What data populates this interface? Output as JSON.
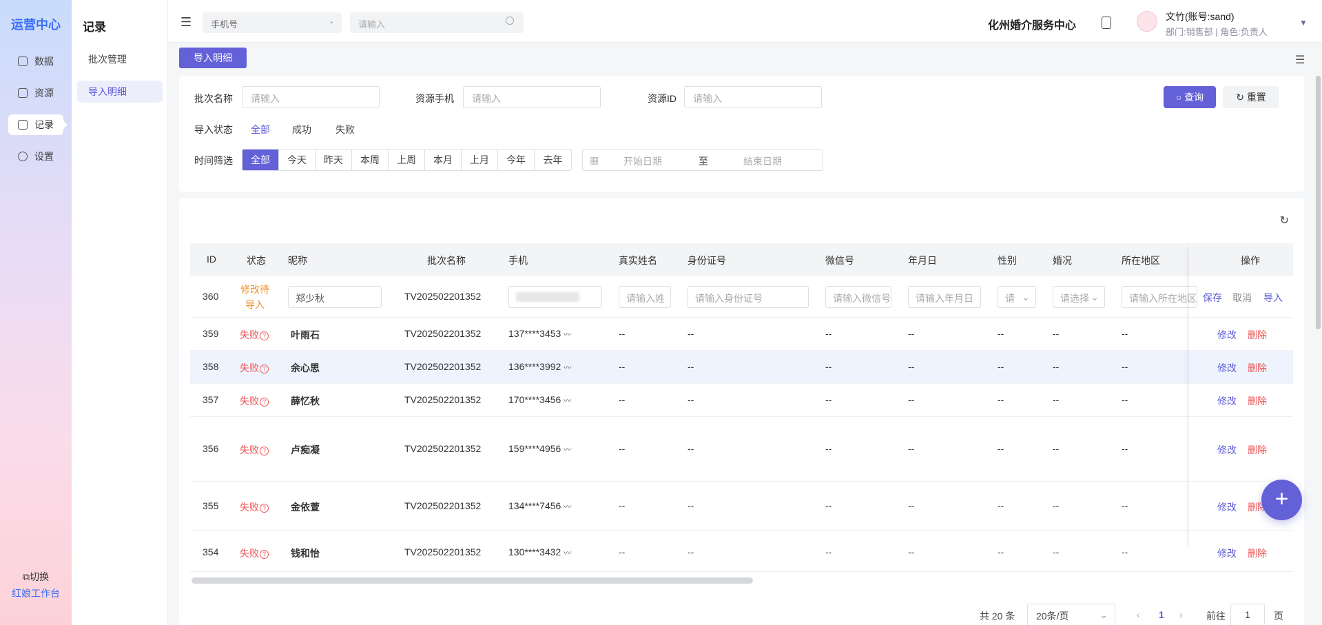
{
  "rail": {
    "brand": "运营中心",
    "items": [
      {
        "label": "数据",
        "icon": "chart-icon"
      },
      {
        "label": "资源",
        "icon": "grid-icon"
      },
      {
        "label": "记录",
        "icon": "document-icon"
      },
      {
        "label": "设置",
        "icon": "gear-icon"
      }
    ],
    "switch_label": "切换",
    "workbench_label": "红娘工作台"
  },
  "submenu": {
    "title": "记录",
    "items": [
      "批次管理",
      "导入明细"
    ],
    "active_index": 1
  },
  "header": {
    "search_type": "手机号",
    "search_placeholder": "请输入",
    "org_name": "化州婚介服务中心",
    "user_name": "文竹(账号:sand)",
    "user_meta": "部门:销售部 | 角色:负责人"
  },
  "page_tab": "导入明细",
  "filters": {
    "batch_name_label": "批次名称",
    "batch_name_placeholder": "请输入",
    "phone_label": "资源手机",
    "phone_placeholder": "请输入",
    "resource_id_label": "资源ID",
    "resource_id_placeholder": "请输入",
    "query_label": "查询",
    "reset_label": "重置",
    "status_label": "导入状态",
    "status_options": [
      "全部",
      "成功",
      "失败"
    ],
    "status_selected": "全部",
    "time_label": "时间筛选",
    "time_options": [
      "全部",
      "今天",
      "昨天",
      "本周",
      "上周",
      "本月",
      "上月",
      "今年",
      "去年"
    ],
    "time_selected": "全部",
    "start_placeholder": "开始日期",
    "range_sep": "至",
    "end_placeholder": "结束日期"
  },
  "table": {
    "columns": [
      "ID",
      "状态",
      "昵称",
      "批次名称",
      "手机",
      "真实姓名",
      "身份证号",
      "微信号",
      "年月日",
      "性别",
      "婚况",
      "所在地区",
      "操作"
    ],
    "edit_row": {
      "id": "360",
      "status": "修改待导入",
      "nickname_value": "郑少秋",
      "batch": "TV202502201352",
      "name_placeholder": "请输入姓",
      "idcard_placeholder": "请输入身份证号",
      "wechat_placeholder": "请输入微信号",
      "birthday_placeholder": "请输入年月日",
      "gender_placeholder": "请",
      "marriage_placeholder": "请选择",
      "region_placeholder": "请输入所在地区",
      "save": "保存",
      "cancel": "取消",
      "import": "导入"
    },
    "rows": [
      {
        "id": "359",
        "status": "失败",
        "nickname": "叶雨石",
        "batch": "TV202502201352",
        "phone": "137****3453",
        "name": "--",
        "idcard": "--",
        "wechat": "--",
        "birthday": "--",
        "gender": "--",
        "marriage": "--",
        "region": "--"
      },
      {
        "id": "358",
        "status": "失败",
        "nickname": "余心思",
        "batch": "TV202502201352",
        "phone": "136****3992",
        "name": "--",
        "idcard": "--",
        "wechat": "--",
        "birthday": "--",
        "gender": "--",
        "marriage": "--",
        "region": "--"
      },
      {
        "id": "357",
        "status": "失败",
        "nickname": "薛忆秋",
        "batch": "TV202502201352",
        "phone": "170****3456",
        "name": "--",
        "idcard": "--",
        "wechat": "--",
        "birthday": "--",
        "gender": "--",
        "marriage": "--",
        "region": "--"
      },
      {
        "id": "356",
        "status": "失败",
        "nickname": "卢痴凝",
        "batch": "TV202502201352",
        "phone": "159****4956",
        "name": "--",
        "idcard": "--",
        "wechat": "--",
        "birthday": "--",
        "gender": "--",
        "marriage": "--",
        "region": "--"
      },
      {
        "id": "355",
        "status": "失败",
        "nickname": "金依萱",
        "batch": "TV202502201352",
        "phone": "134****7456",
        "name": "--",
        "idcard": "--",
        "wechat": "--",
        "birthday": "--",
        "gender": "--",
        "marriage": "--",
        "region": "--"
      },
      {
        "id": "354",
        "status": "失败",
        "nickname": "钱和怡",
        "batch": "TV202502201352",
        "phone": "130****3432",
        "name": "--",
        "idcard": "--",
        "wechat": "--",
        "birthday": "--",
        "gender": "--",
        "marriage": "--",
        "region": "--"
      }
    ],
    "edit_label": "修改",
    "delete_label": "删除"
  },
  "pagination": {
    "total": "共 20 条",
    "page_size": "20条/页",
    "current": "1",
    "goto_label": "前往",
    "goto_value": "1",
    "page_suffix": "页"
  },
  "colors": {
    "accent": "#6360d8",
    "fail": "#f05656",
    "pending": "#f2912e",
    "brand": "#3b6ff5"
  }
}
